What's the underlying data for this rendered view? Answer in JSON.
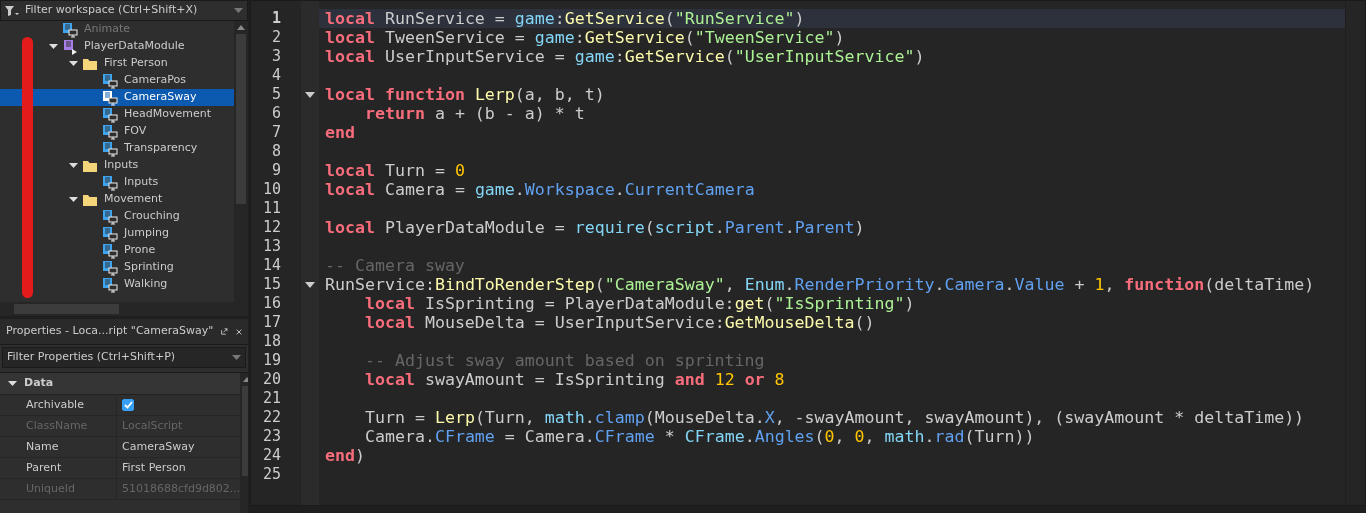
{
  "explorer": {
    "filter": {
      "placeholder": "Filter workspace (Ctrl+Shift+X)"
    },
    "tree": [
      {
        "label": "Animate",
        "kind": "localscript",
        "selected": false
      },
      {
        "label": "PlayerDataModule",
        "kind": "module",
        "selected": false,
        "expanded": true,
        "children": [
          {
            "label": "First Person",
            "kind": "folder",
            "selected": false,
            "expanded": true,
            "children": [
              {
                "label": "CameraPos",
                "kind": "localscript",
                "selected": false
              },
              {
                "label": "CameraSway",
                "kind": "localscript",
                "selected": true
              },
              {
                "label": "HeadMovement",
                "kind": "localscript",
                "selected": false
              },
              {
                "label": "FOV",
                "kind": "localscript",
                "selected": false
              },
              {
                "label": "Transparency",
                "kind": "localscript",
                "selected": false
              }
            ]
          },
          {
            "label": "Inputs",
            "kind": "folder",
            "selected": false,
            "expanded": true,
            "children": [
              {
                "label": "Inputs",
                "kind": "localscript",
                "selected": false
              }
            ]
          },
          {
            "label": "Movement",
            "kind": "folder",
            "selected": false,
            "expanded": true,
            "children": [
              {
                "label": "Crouching",
                "kind": "localscript",
                "selected": false
              },
              {
                "label": "Jumping",
                "kind": "localscript",
                "selected": false
              },
              {
                "label": "Prone",
                "kind": "localscript",
                "selected": false
              },
              {
                "label": "Sprinting",
                "kind": "localscript",
                "selected": false
              },
              {
                "label": "Walking",
                "kind": "localscript",
                "selected": false
              }
            ]
          }
        ]
      }
    ]
  },
  "properties": {
    "title": "Properties - Loca...ript \"CameraSway\"",
    "filter": {
      "placeholder": "Filter Properties (Ctrl+Shift+P)"
    },
    "sections": [
      {
        "label": "Data",
        "expanded": true,
        "rows": [
          {
            "name": "Archivable",
            "kind": "bool",
            "checked": true,
            "disabled": false
          },
          {
            "name": "ClassName",
            "kind": "text",
            "value": "LocalScript",
            "disabled": true
          },
          {
            "name": "Name",
            "kind": "text",
            "value": "CameraSway",
            "disabled": false
          },
          {
            "name": "Parent",
            "kind": "text",
            "value": "First Person",
            "disabled": false
          },
          {
            "name": "UniqueId",
            "kind": "text",
            "value": "51018688cfd9d802...",
            "disabled": true
          }
        ]
      }
    ]
  },
  "editor": {
    "lines": [
      {
        "number": "1",
        "current": true,
        "tokens": [
          {
            "kind": "keyword",
            "text": "local "
          },
          {
            "kind": "plain",
            "text": "RunService = "
          },
          {
            "kind": "global",
            "text": "game"
          },
          {
            "kind": "plain",
            "text": ":"
          },
          {
            "kind": "call",
            "text": "GetService"
          },
          {
            "kind": "plain",
            "text": "("
          },
          {
            "kind": "string",
            "text": "\"RunService\""
          },
          {
            "kind": "plain",
            "text": ")"
          }
        ]
      },
      {
        "number": "2",
        "current": false,
        "tokens": [
          {
            "kind": "keyword",
            "text": "local "
          },
          {
            "kind": "plain",
            "text": "TweenService = "
          },
          {
            "kind": "global",
            "text": "game"
          },
          {
            "kind": "plain",
            "text": ":"
          },
          {
            "kind": "call",
            "text": "GetService"
          },
          {
            "kind": "plain",
            "text": "("
          },
          {
            "kind": "string",
            "text": "\"TweenService\""
          },
          {
            "kind": "plain",
            "text": ")"
          }
        ]
      },
      {
        "number": "3",
        "current": false,
        "tokens": [
          {
            "kind": "keyword",
            "text": "local "
          },
          {
            "kind": "plain",
            "text": "UserInputService = "
          },
          {
            "kind": "global",
            "text": "game"
          },
          {
            "kind": "plain",
            "text": ":"
          },
          {
            "kind": "call",
            "text": "GetService"
          },
          {
            "kind": "plain",
            "text": "("
          },
          {
            "kind": "string",
            "text": "\"UserInputService\""
          },
          {
            "kind": "plain",
            "text": ")"
          }
        ]
      },
      {
        "number": "4",
        "current": false
      },
      {
        "number": "5",
        "current": false,
        "foldable": true,
        "tokens": [
          {
            "kind": "keyword",
            "text": "local "
          },
          {
            "kind": "keyword",
            "text": "function "
          },
          {
            "kind": "call",
            "text": "Lerp"
          },
          {
            "kind": "plain",
            "text": "(a, b, t)"
          }
        ]
      },
      {
        "number": "6",
        "current": false,
        "tokens": [
          {
            "kind": "keyword",
            "text": "    return"
          },
          {
            "kind": "plain",
            "text": " a + (b - a) * t"
          }
        ]
      },
      {
        "number": "7",
        "current": false,
        "tokens": [
          {
            "kind": "keyword",
            "text": "end"
          }
        ]
      },
      {
        "number": "8",
        "current": false
      },
      {
        "number": "9",
        "current": false,
        "tokens": [
          {
            "kind": "keyword",
            "text": "local "
          },
          {
            "kind": "plain",
            "text": "Turn = "
          },
          {
            "kind": "number",
            "text": "0"
          }
        ]
      },
      {
        "number": "10",
        "current": false,
        "tokens": [
          {
            "kind": "keyword",
            "text": "local "
          },
          {
            "kind": "plain",
            "text": "Camera = "
          },
          {
            "kind": "global",
            "text": "game"
          },
          {
            "kind": "plain",
            "text": "."
          },
          {
            "kind": "property",
            "text": "Workspace"
          },
          {
            "kind": "plain",
            "text": "."
          },
          {
            "kind": "property",
            "text": "CurrentCamera"
          }
        ]
      },
      {
        "number": "11",
        "current": false
      },
      {
        "number": "12",
        "current": false,
        "tokens": [
          {
            "kind": "keyword",
            "text": "local "
          },
          {
            "kind": "plain",
            "text": "PlayerDataModule = "
          },
          {
            "kind": "global",
            "text": "require"
          },
          {
            "kind": "plain",
            "text": "("
          },
          {
            "kind": "global",
            "text": "script"
          },
          {
            "kind": "plain",
            "text": "."
          },
          {
            "kind": "property",
            "text": "Parent"
          },
          {
            "kind": "plain",
            "text": "."
          },
          {
            "kind": "property",
            "text": "Parent"
          },
          {
            "kind": "plain",
            "text": ")"
          }
        ]
      },
      {
        "number": "13",
        "current": false
      },
      {
        "number": "14",
        "current": false,
        "tokens": [
          {
            "kind": "comment",
            "text": "-- Camera sway"
          }
        ]
      },
      {
        "number": "15",
        "current": false,
        "foldable": true,
        "tokens": [
          {
            "kind": "plain",
            "text": "RunService:"
          },
          {
            "kind": "call",
            "text": "BindToRenderStep"
          },
          {
            "kind": "plain",
            "text": "("
          },
          {
            "kind": "string",
            "text": "\"CameraSway\""
          },
          {
            "kind": "plain",
            "text": ", "
          },
          {
            "kind": "global",
            "text": "Enum"
          },
          {
            "kind": "plain",
            "text": "."
          },
          {
            "kind": "property",
            "text": "RenderPriority"
          },
          {
            "kind": "plain",
            "text": "."
          },
          {
            "kind": "property",
            "text": "Camera"
          },
          {
            "kind": "plain",
            "text": "."
          },
          {
            "kind": "property",
            "text": "Value"
          },
          {
            "kind": "plain",
            "text": " + "
          },
          {
            "kind": "number",
            "text": "1"
          },
          {
            "kind": "plain",
            "text": ", "
          },
          {
            "kind": "keyword",
            "text": "function"
          },
          {
            "kind": "plain",
            "text": "(deltaTime)"
          }
        ]
      },
      {
        "number": "16",
        "current": false,
        "tokens": [
          {
            "kind": "keyword",
            "text": "    local"
          },
          {
            "kind": "plain",
            "text": " IsSprinting = PlayerDataModule:"
          },
          {
            "kind": "call",
            "text": "get"
          },
          {
            "kind": "plain",
            "text": "("
          },
          {
            "kind": "string",
            "text": "\"IsSprinting\""
          },
          {
            "kind": "plain",
            "text": ")"
          }
        ]
      },
      {
        "number": "17",
        "current": false,
        "tokens": [
          {
            "kind": "keyword",
            "text": "    local"
          },
          {
            "kind": "plain",
            "text": " MouseDelta = UserInputService:"
          },
          {
            "kind": "call",
            "text": "GetMouseDelta"
          },
          {
            "kind": "plain",
            "text": "()"
          }
        ]
      },
      {
        "number": "18",
        "current": false
      },
      {
        "number": "19",
        "current": false,
        "tokens": [
          {
            "kind": "comment",
            "text": "    -- Adjust sway amount based on sprinting"
          }
        ]
      },
      {
        "number": "20",
        "current": false,
        "tokens": [
          {
            "kind": "keyword",
            "text": "    local"
          },
          {
            "kind": "plain",
            "text": " swayAmount = IsSprinting "
          },
          {
            "kind": "keyword",
            "text": "and "
          },
          {
            "kind": "number",
            "text": "12 "
          },
          {
            "kind": "keyword",
            "text": "or "
          },
          {
            "kind": "number",
            "text": "8"
          }
        ]
      },
      {
        "number": "21",
        "current": false
      },
      {
        "number": "22",
        "current": false,
        "tokens": [
          {
            "kind": "plain",
            "text": "    Turn = "
          },
          {
            "kind": "call",
            "text": "Lerp"
          },
          {
            "kind": "plain",
            "text": "(Turn, "
          },
          {
            "kind": "global",
            "text": "math"
          },
          {
            "kind": "plain",
            "text": "."
          },
          {
            "kind": "property",
            "text": "clamp"
          },
          {
            "kind": "plain",
            "text": "(MouseDelta."
          },
          {
            "kind": "property",
            "text": "X"
          },
          {
            "kind": "plain",
            "text": ", -swayAmount, swayAmount), (swayAmount * deltaTime))"
          }
        ]
      },
      {
        "number": "23",
        "current": false,
        "tokens": [
          {
            "kind": "plain",
            "text": "    Camera."
          },
          {
            "kind": "property",
            "text": "CFrame"
          },
          {
            "kind": "plain",
            "text": " = Camera."
          },
          {
            "kind": "property",
            "text": "CFrame"
          },
          {
            "kind": "plain",
            "text": " * "
          },
          {
            "kind": "global",
            "text": "CFrame"
          },
          {
            "kind": "plain",
            "text": "."
          },
          {
            "kind": "property",
            "text": "Angles"
          },
          {
            "kind": "plain",
            "text": "("
          },
          {
            "kind": "number",
            "text": "0"
          },
          {
            "kind": "plain",
            "text": ", "
          },
          {
            "kind": "number",
            "text": "0"
          },
          {
            "kind": "plain",
            "text": ", "
          },
          {
            "kind": "global",
            "text": "math"
          },
          {
            "kind": "plain",
            "text": "."
          },
          {
            "kind": "property",
            "text": "rad"
          },
          {
            "kind": "plain",
            "text": "(Turn))"
          }
        ]
      },
      {
        "number": "24",
        "current": false,
        "tokens": [
          {
            "kind": "keyword",
            "text": "end"
          },
          {
            "kind": "plain",
            "text": ")"
          }
        ]
      },
      {
        "number": "25",
        "current": false
      }
    ]
  }
}
